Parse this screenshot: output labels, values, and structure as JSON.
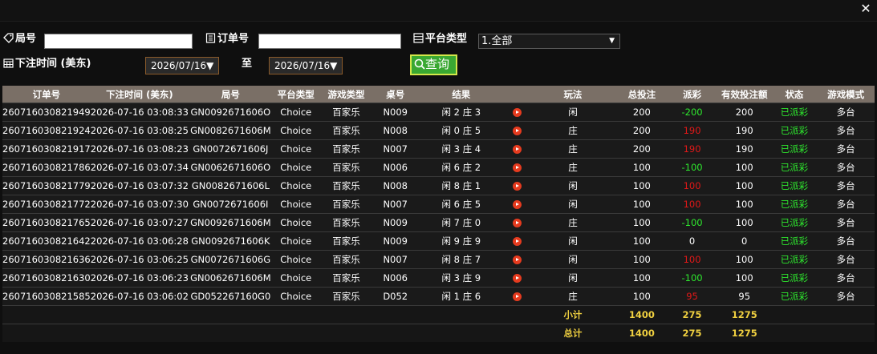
{
  "filters": {
    "round_label": "局号",
    "order_label": "订单号",
    "platform_label": "平台类型",
    "platform_value": "1.全部",
    "time_label": "下注时间 (美东)",
    "date_from": "2026/07/16",
    "to_label": "至",
    "date_to": "2026/07/16",
    "query_label": "查询"
  },
  "table": {
    "headers": [
      "订单号",
      "下注时间 (美东)",
      "局号",
      "平台类型",
      "游戏类型",
      "桌号",
      "结果",
      "",
      "玩法",
      "总投注",
      "派彩",
      "有效投注额",
      "状态",
      "游戏模式"
    ],
    "rows": [
      {
        "order": "260716030821949",
        "time": "2026-07-16 03:08:33",
        "round": "GN0092671606O",
        "platform": "Choice",
        "game": "百家乐",
        "table": "N009",
        "result": "闲 2 庄 3",
        "play": "闲",
        "bet": "200",
        "payout": "-200",
        "payout_color": "green",
        "valid": "200",
        "status": "已派彩",
        "mode": "多台"
      },
      {
        "order": "260716030821924",
        "time": "2026-07-16 03:08:25",
        "round": "GN0082671606M",
        "platform": "Choice",
        "game": "百家乐",
        "table": "N008",
        "result": "闲 0 庄 5",
        "play": "庄",
        "bet": "200",
        "payout": "190",
        "payout_color": "red",
        "valid": "190",
        "status": "已派彩",
        "mode": "多台"
      },
      {
        "order": "260716030821917",
        "time": "2026-07-16 03:08:23",
        "round": "GN0072671606J",
        "platform": "Choice",
        "game": "百家乐",
        "table": "N007",
        "result": "闲 3 庄 4",
        "play": "庄",
        "bet": "200",
        "payout": "190",
        "payout_color": "red",
        "valid": "190",
        "status": "已派彩",
        "mode": "多台"
      },
      {
        "order": "260716030821786",
        "time": "2026-07-16 03:07:34",
        "round": "GN0062671606O",
        "platform": "Choice",
        "game": "百家乐",
        "table": "N006",
        "result": "闲 6 庄 2",
        "play": "庄",
        "bet": "100",
        "payout": "-100",
        "payout_color": "green",
        "valid": "100",
        "status": "已派彩",
        "mode": "多台"
      },
      {
        "order": "260716030821779",
        "time": "2026-07-16 03:07:32",
        "round": "GN0082671606L",
        "platform": "Choice",
        "game": "百家乐",
        "table": "N008",
        "result": "闲 8 庄 1",
        "play": "闲",
        "bet": "100",
        "payout": "100",
        "payout_color": "red",
        "valid": "100",
        "status": "已派彩",
        "mode": "多台"
      },
      {
        "order": "260716030821772",
        "time": "2026-07-16 03:07:30",
        "round": "GN0072671606I",
        "platform": "Choice",
        "game": "百家乐",
        "table": "N007",
        "result": "闲 6 庄 5",
        "play": "闲",
        "bet": "100",
        "payout": "100",
        "payout_color": "red",
        "valid": "100",
        "status": "已派彩",
        "mode": "多台"
      },
      {
        "order": "260716030821765",
        "time": "2026-07-16 03:07:27",
        "round": "GN0092671606M",
        "platform": "Choice",
        "game": "百家乐",
        "table": "N009",
        "result": "闲 7 庄 0",
        "play": "庄",
        "bet": "100",
        "payout": "-100",
        "payout_color": "green",
        "valid": "100",
        "status": "已派彩",
        "mode": "多台"
      },
      {
        "order": "260716030821642",
        "time": "2026-07-16 03:06:28",
        "round": "GN0092671606K",
        "platform": "Choice",
        "game": "百家乐",
        "table": "N009",
        "result": "闲 9 庄 9",
        "play": "闲",
        "bet": "100",
        "payout": "0",
        "payout_color": "white",
        "valid": "0",
        "status": "已派彩",
        "mode": "多台"
      },
      {
        "order": "260716030821636",
        "time": "2026-07-16 03:06:25",
        "round": "GN0072671606G",
        "platform": "Choice",
        "game": "百家乐",
        "table": "N007",
        "result": "闲 8 庄 7",
        "play": "闲",
        "bet": "100",
        "payout": "100",
        "payout_color": "red",
        "valid": "100",
        "status": "已派彩",
        "mode": "多台"
      },
      {
        "order": "260716030821630",
        "time": "2026-07-16 03:06:23",
        "round": "GN0062671606M",
        "platform": "Choice",
        "game": "百家乐",
        "table": "N006",
        "result": "闲 3 庄 9",
        "play": "闲",
        "bet": "100",
        "payout": "-100",
        "payout_color": "green",
        "valid": "100",
        "status": "已派彩",
        "mode": "多台"
      },
      {
        "order": "260716030821585",
        "time": "2026-07-16 03:06:02",
        "round": "GD052267160G0",
        "platform": "Choice",
        "game": "百家乐",
        "table": "D052",
        "result": "闲 1 庄 6",
        "play": "庄",
        "bet": "100",
        "payout": "95",
        "payout_color": "red",
        "valid": "95",
        "status": "已派彩",
        "mode": "多台"
      }
    ],
    "subtotal": {
      "label": "小计",
      "bet": "1400",
      "payout": "275",
      "valid": "1275"
    },
    "total": {
      "label": "总计",
      "bet": "1400",
      "payout": "275",
      "valid": "1275"
    }
  },
  "colors": {
    "status_green": "#2ee82e",
    "payout_red": "#e01818",
    "header_bg": "#7a6f66",
    "query_button": "#3aa832",
    "summary_yellow": "#f0d040"
  }
}
